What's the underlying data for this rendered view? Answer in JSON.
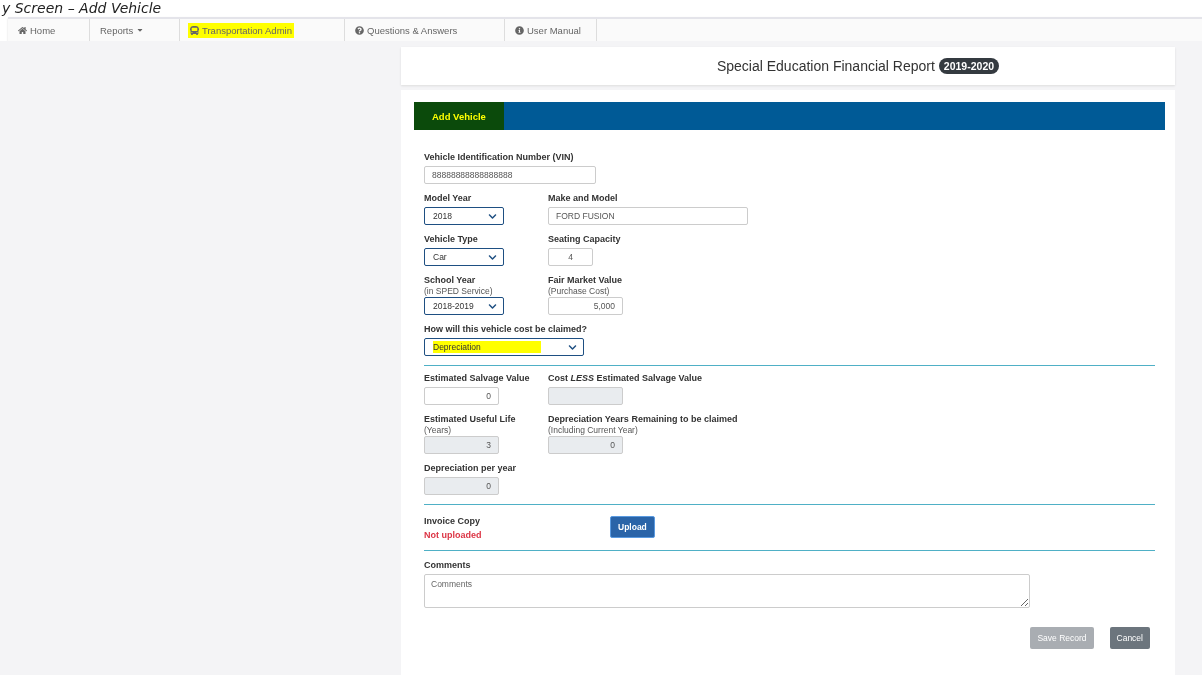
{
  "caption": "y Screen – Add Vehicle",
  "nav": [
    {
      "label": "Home",
      "caret": false,
      "highlighted": false
    },
    {
      "label": "Reports",
      "caret": true,
      "highlighted": false
    },
    {
      "label": "Transportation Admin",
      "caret": false,
      "highlighted": true
    },
    {
      "label": "Questions & Answers",
      "caret": false,
      "highlighted": false
    },
    {
      "label": "User Manual",
      "caret": false,
      "highlighted": false
    }
  ],
  "report": {
    "title": "Special Education Financial Report",
    "year": "2019-2020"
  },
  "panel": {
    "title": "Add Vehicle",
    "highlighted": true
  },
  "sections": [
    {
      "rows": [
        [
          {
            "label": "Vehicle Identification Number (VIN)",
            "kind": "input",
            "value": "88888888888888888"
          }
        ],
        [
          {
            "label": "Model Year",
            "kind": "select",
            "value": "2018"
          },
          {
            "label": "Make and Model",
            "kind": "input",
            "value": "FORD FUSION"
          }
        ],
        [
          {
            "label": "Vehicle Type",
            "kind": "select",
            "value": "Car"
          },
          {
            "label": "Seating Capacity",
            "kind": "input",
            "value": "4"
          }
        ],
        [
          {
            "label": "School Year",
            "sublabel": "(in SPED Service)",
            "kind": "select",
            "value": "2018-2019"
          },
          {
            "label": "Fair Market Value",
            "sublabel": "(Purchase Cost)",
            "kind": "input",
            "value": "5,000"
          }
        ],
        [
          {
            "label": "How will this vehicle cost be claimed?",
            "kind": "select",
            "value": "Depreciation",
            "highlighted": true
          }
        ]
      ]
    },
    {
      "rows": [
        [
          {
            "label": "Estimated Salvage Value",
            "kind": "input",
            "value": "0"
          },
          {
            "label": "Cost *LESS* Estimated Salvage Value",
            "kind": "readonly"
          }
        ],
        [
          {
            "label": "Estimated Useful Life",
            "sublabel": "(Years)",
            "kind": "readonly",
            "value": "3"
          },
          {
            "label": "Depreciation Years Remaining to be claimed",
            "sublabel": "(Including Current Year)",
            "kind": "readonly",
            "value": "0"
          }
        ],
        [
          {
            "label": "Depreciation per year",
            "kind": "readonly",
            "value": "0"
          }
        ]
      ]
    }
  ],
  "invoice": {
    "label": "Invoice Copy",
    "status": "Not uploaded",
    "uploaded": false,
    "button": "Upload"
  },
  "comments": {
    "label": "Comments",
    "placeholder": "Comments"
  },
  "buttons": [
    {
      "label": "Save Record",
      "disabled": true
    },
    {
      "label": "Cancel",
      "disabled": false
    }
  ]
}
